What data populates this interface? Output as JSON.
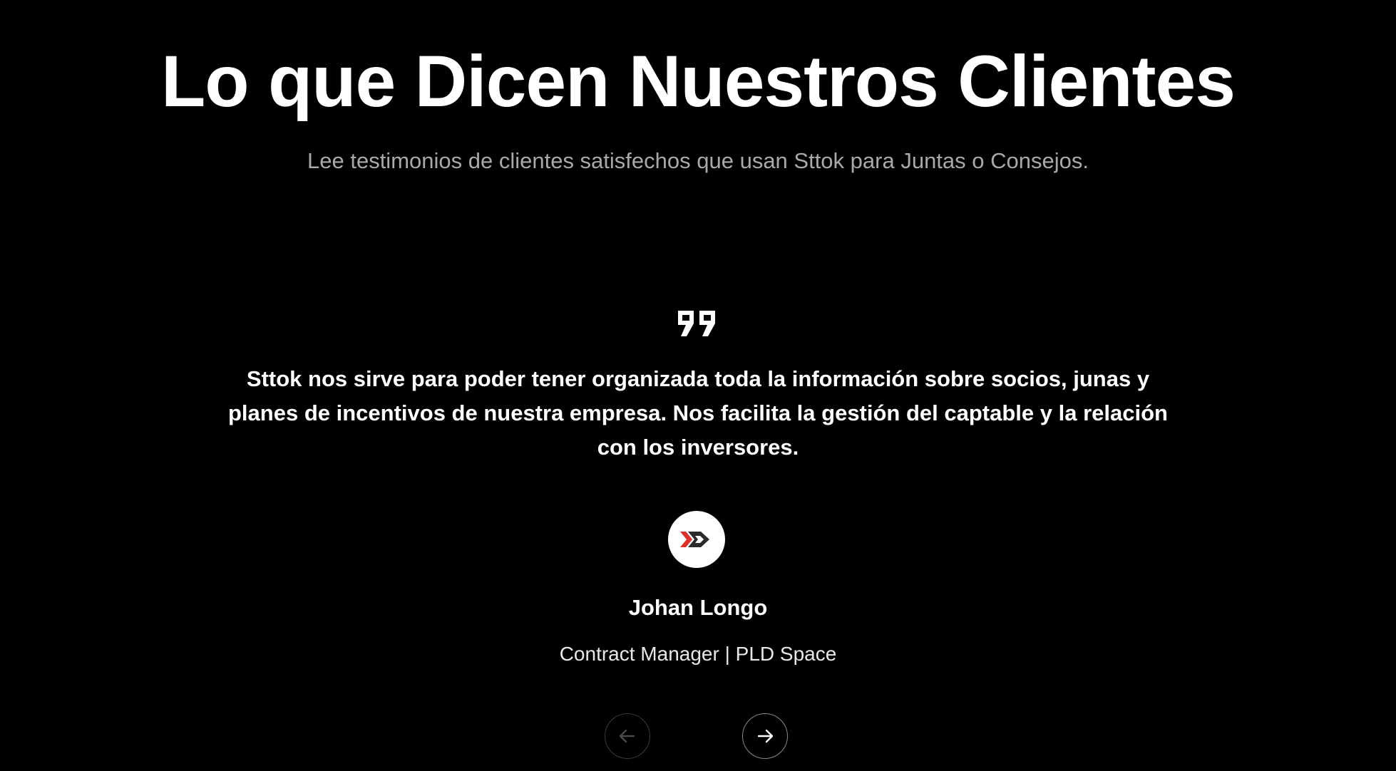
{
  "header": {
    "title": "Lo que Dicen Nuestros Clientes",
    "subtitle": "Lee testimonios de clientes satisfechos que usan Sttok para Juntas o Consejos."
  },
  "testimonial": {
    "quote_icon": "quote-icon",
    "text": "Sttok nos sirve para poder tener organizada toda la información sobre socios, junas y planes de incentivos de nuestra empresa. Nos facilita la gestión del captable y la relación con los inversores.",
    "avatar_icon": "company-logo",
    "author_name": "Johan Longo",
    "author_role": "Contract Manager | PLD Space"
  },
  "navigation": {
    "prev_icon": "arrow-left-icon",
    "next_icon": "arrow-right-icon",
    "prev_disabled": true
  },
  "colors": {
    "background": "#000000",
    "text": "#ffffff",
    "subtitle": "#a9a9a9",
    "logo_red": "#d9312b",
    "logo_dark": "#2b2b2b"
  }
}
